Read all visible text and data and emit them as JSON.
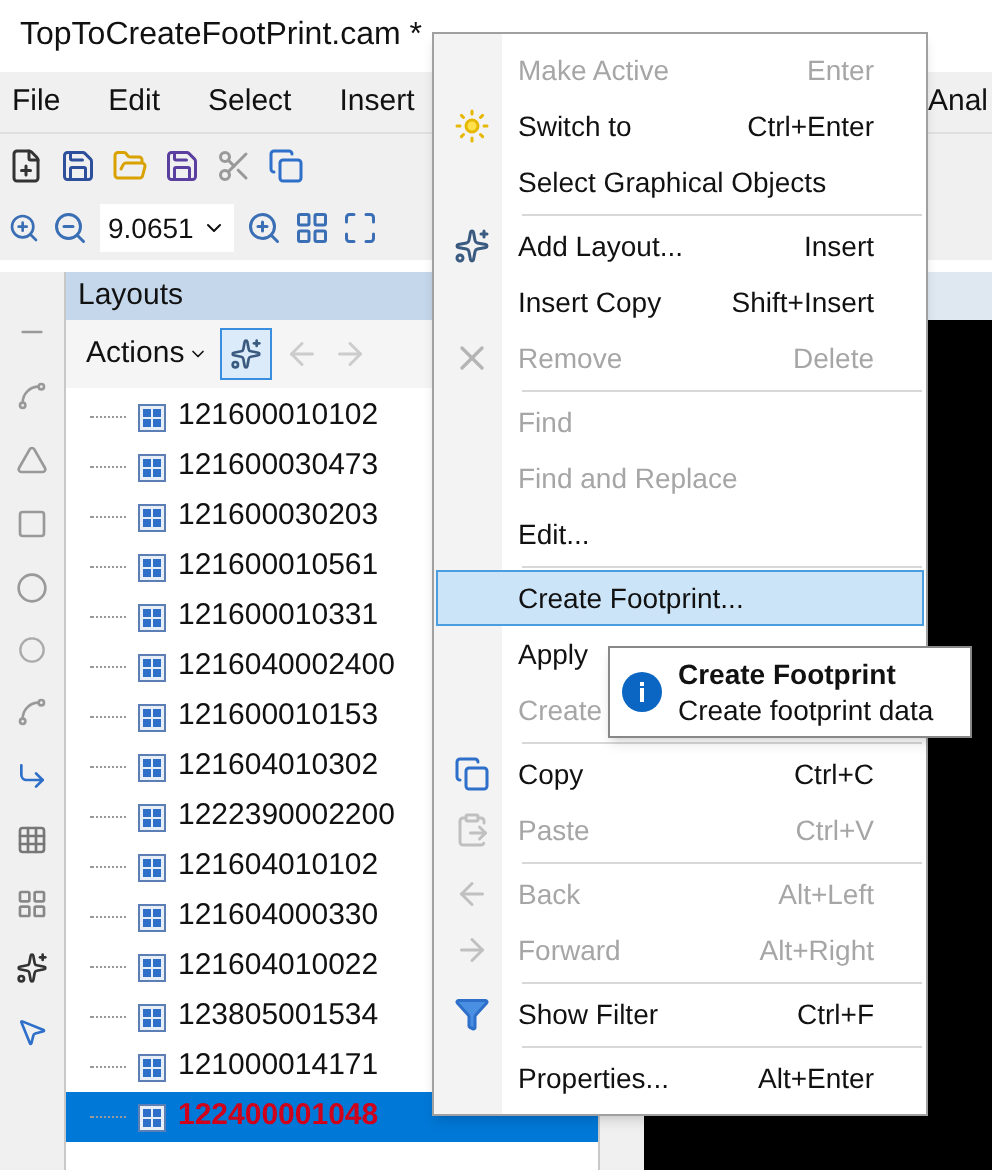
{
  "window": {
    "title": "TopToCreateFootPrint.cam *"
  },
  "menu_bar": [
    {
      "label": "File"
    },
    {
      "label": "Edit"
    },
    {
      "label": "Select"
    },
    {
      "label": "Insert"
    },
    {
      "label": "Anal"
    }
  ],
  "zoom_field": {
    "value": "9.0651"
  },
  "layouts_panel": {
    "title": "Layouts",
    "actions_button": "Actions",
    "items": [
      {
        "label": "121600010102",
        "selected": false
      },
      {
        "label": "121600030473",
        "selected": false
      },
      {
        "label": "121600030203",
        "selected": false
      },
      {
        "label": "121600010561",
        "selected": false
      },
      {
        "label": "121600010331",
        "selected": false
      },
      {
        "label": "1216040002400",
        "selected": false
      },
      {
        "label": "121600010153",
        "selected": false
      },
      {
        "label": "121604010302",
        "selected": false
      },
      {
        "label": "1222390002200",
        "selected": false
      },
      {
        "label": "121604010102",
        "selected": false
      },
      {
        "label": "121604000330",
        "selected": false
      },
      {
        "label": "121604010022",
        "selected": false
      },
      {
        "label": "123805001534",
        "selected": false
      },
      {
        "label": "121000014171",
        "selected": false
      },
      {
        "label": "122400001048",
        "selected": true
      }
    ]
  },
  "context_menu": {
    "items": [
      {
        "kind": "item",
        "label": "Make Active",
        "shortcut": "Enter",
        "disabled": true,
        "highlighted": false
      },
      {
        "kind": "item",
        "label": "Switch to",
        "shortcut": "Ctrl+Enter",
        "disabled": false,
        "highlighted": false
      },
      {
        "kind": "item",
        "label": "Select Graphical Objects",
        "disabled": false,
        "highlighted": false
      },
      {
        "kind": "separator"
      },
      {
        "kind": "item",
        "label": "Add Layout...",
        "shortcut": "Insert",
        "disabled": false,
        "highlighted": false
      },
      {
        "kind": "item",
        "label": "Insert Copy",
        "shortcut": "Shift+Insert",
        "disabled": false,
        "highlighted": false
      },
      {
        "kind": "item",
        "label": "Remove",
        "shortcut": "Delete",
        "disabled": true,
        "highlighted": false
      },
      {
        "kind": "separator"
      },
      {
        "kind": "item",
        "label": "Find",
        "disabled": true,
        "highlighted": false
      },
      {
        "kind": "item",
        "label": "Find and Replace",
        "disabled": true,
        "highlighted": false
      },
      {
        "kind": "item",
        "label": "Edit...",
        "disabled": false,
        "highlighted": false
      },
      {
        "kind": "separator"
      },
      {
        "kind": "item",
        "label": "Create Footprint...",
        "disabled": false,
        "highlighted": true
      },
      {
        "kind": "item",
        "label": "Apply",
        "disabled": false,
        "highlighted": false
      },
      {
        "kind": "item",
        "label": "Create",
        "disabled": true,
        "highlighted": false
      },
      {
        "kind": "separator"
      },
      {
        "kind": "item",
        "label": "Copy",
        "shortcut": "Ctrl+C",
        "disabled": false,
        "highlighted": false
      },
      {
        "kind": "item",
        "label": "Paste",
        "shortcut": "Ctrl+V",
        "disabled": true,
        "highlighted": false
      },
      {
        "kind": "separator"
      },
      {
        "kind": "item",
        "label": "Back",
        "shortcut": "Alt+Left",
        "disabled": true,
        "highlighted": false
      },
      {
        "kind": "item",
        "label": "Forward",
        "shortcut": "Alt+Right",
        "disabled": true,
        "highlighted": false
      },
      {
        "kind": "separator"
      },
      {
        "kind": "item",
        "label": "Show Filter",
        "shortcut": "Ctrl+F",
        "disabled": false,
        "highlighted": false
      },
      {
        "kind": "separator"
      },
      {
        "kind": "item",
        "label": "Properties...",
        "shortcut": "Alt+Enter",
        "disabled": false,
        "highlighted": false
      }
    ]
  },
  "tooltip": {
    "title": "Create Footprint",
    "text": "Create footprint data"
  }
}
